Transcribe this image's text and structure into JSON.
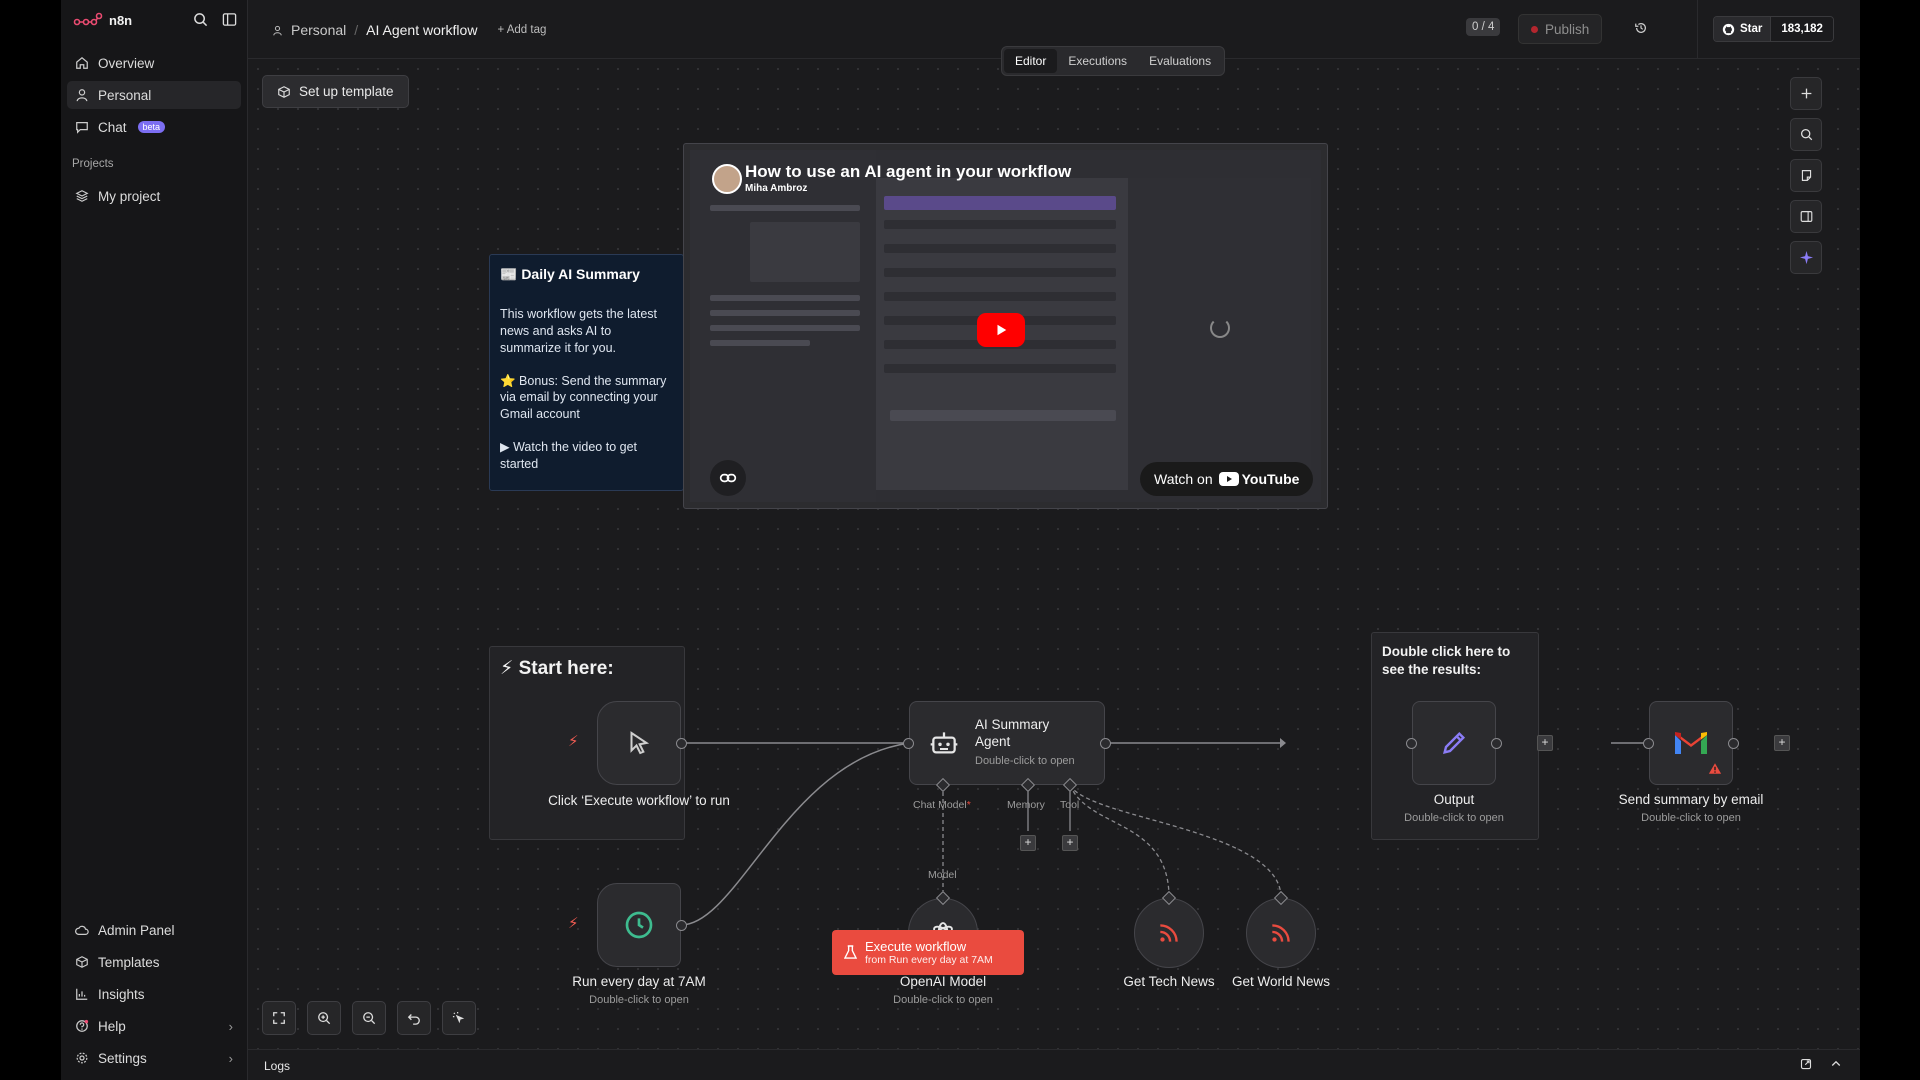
{
  "app": {
    "brand": "n8n"
  },
  "sidebar": {
    "items_top": [
      {
        "label": "Overview",
        "icon": "home-icon"
      },
      {
        "label": "Personal",
        "icon": "user-icon"
      },
      {
        "label": "Chat",
        "icon": "chat-icon",
        "badge": "beta"
      }
    ],
    "projects_label": "Projects",
    "project_item": "My project",
    "items_bottom": [
      {
        "label": "Admin Panel",
        "icon": "cloud-icon"
      },
      {
        "label": "Templates",
        "icon": "box-icon"
      },
      {
        "label": "Insights",
        "icon": "bar-chart-icon"
      },
      {
        "label": "Help",
        "icon": "help-icon"
      },
      {
        "label": "Settings",
        "icon": "gear-icon"
      }
    ]
  },
  "header": {
    "breadcrumb_root": "Personal",
    "workflow_name": "AI Agent workflow",
    "add_tag": "+ Add tag",
    "counter": "0 / 4",
    "publish": "Publish",
    "github_star": "Star",
    "github_count": "183,182",
    "tabs": [
      "Editor",
      "Executions",
      "Evaluations"
    ]
  },
  "canvas": {
    "setup_template": "Set up template",
    "sticky_summary": {
      "title": "📰 Daily AI Summary",
      "p1": "This workflow gets the latest news and asks AI to summarize it for you.",
      "p2": "⭐ Bonus: Send the summary via email by connecting your Gmail account",
      "p3": "▶ Watch the video to get started"
    },
    "video": {
      "title": "How to use an AI agent in your workflow",
      "author": "Miha Ambroz",
      "watch_on": "Watch on",
      "youtube": "YouTube"
    },
    "start_group": {
      "title": "⚡ Start here:"
    },
    "results_group": {
      "title": "Double click here to see the results:"
    },
    "nodes": {
      "manual": {
        "label": "Click ‘Execute workflow’ to run"
      },
      "schedule": {
        "label": "Run every day at 7AM",
        "sub": "Double-click to open"
      },
      "agent": {
        "label": "AI Summary Agent",
        "sub": "Double-click to open"
      },
      "openai": {
        "label": "OpenAI Model",
        "sub": "Double-click to open"
      },
      "tech": {
        "label": "Get Tech News"
      },
      "world": {
        "label": "Get World News"
      },
      "output": {
        "label": "Output",
        "sub": "Double-click to open"
      },
      "gmail": {
        "label": "Send summary by email",
        "sub": "Double-click to open"
      }
    },
    "port_labels": {
      "chat_model": "Chat Model",
      "chat_model_required": "*",
      "memory": "Memory",
      "tool": "Tool",
      "model": "Model"
    },
    "execute": {
      "line1": "Execute workflow",
      "line2": "from Run every day at 7AM"
    }
  },
  "logs": {
    "label": "Logs"
  },
  "colors": {
    "accent_red": "#ea4b3f",
    "schedule_green": "#3ebc8f",
    "pencil_purple": "#8b7cf6",
    "sticky_blue": "#0f1c2e"
  }
}
